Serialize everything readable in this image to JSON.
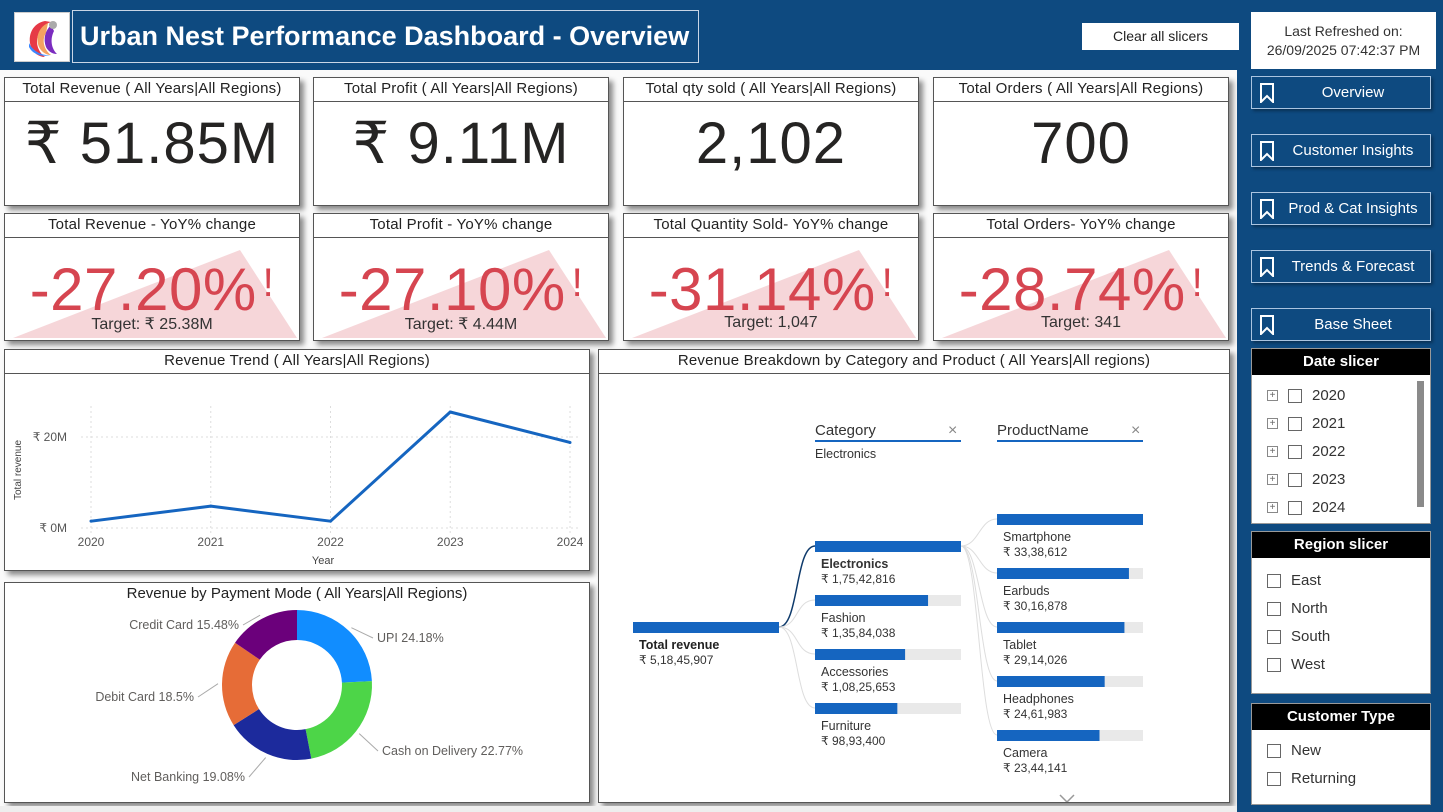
{
  "header": {
    "title": "Urban Nest Performance Dashboard - Overview",
    "clear_button": "Clear all slicers",
    "refresh_label": "Last Refreshed on:",
    "refresh_time": "26/09/2025  07:42:37 PM"
  },
  "kpis": [
    {
      "title": "Total Revenue ( All Years|All Regions)",
      "value": "₹ 51.85M"
    },
    {
      "title": "Total Profit ( All Years|All Regions)",
      "value": "₹ 9.11M"
    },
    {
      "title": "Total qty sold ( All Years|All Regions)",
      "value": "2,102"
    },
    {
      "title": "Total Orders ( All Years|All Regions)",
      "value": "700"
    }
  ],
  "yoy": [
    {
      "title": "Total Revenue  - YoY% change",
      "value": "-27.20%",
      "target": "Target: ₹ 25.38M",
      "alert": "!"
    },
    {
      "title": "Total Profit  - YoY% change",
      "value": "-27.10%",
      "target": "Target: ₹ 4.44M",
      "alert": "!"
    },
    {
      "title": "Total Quantity Sold- YoY% change",
      "value": "-31.14%",
      "target": "Target: 1,047",
      "alert": "!"
    },
    {
      "title": "Total Orders- YoY% change",
      "value": "-28.74%",
      "target": "Target: 341",
      "alert": "!"
    }
  ],
  "colors": {
    "navy": "#0e4a80",
    "negative": "#d64550",
    "line": "#1565c0",
    "bar": "#1565c0"
  },
  "nav": [
    {
      "label": "Overview",
      "icon": "bookmark-icon"
    },
    {
      "label": "Customer Insights",
      "icon": "bookmark-icon"
    },
    {
      "label": "Prod & Cat Insights",
      "icon": "bookmark-icon"
    },
    {
      "label": "Trends & Forecast",
      "icon": "bookmark-icon"
    },
    {
      "label": "Base Sheet",
      "icon": "bookmark-icon"
    }
  ],
  "date_slicer": {
    "title": "Date slicer",
    "items": [
      "2020",
      "2021",
      "2022",
      "2023",
      "2024"
    ]
  },
  "region_slicer": {
    "title": "Region slicer",
    "items": [
      "East",
      "North",
      "South",
      "West"
    ]
  },
  "customer_slicer": {
    "title": "Customer Type",
    "items": [
      "New",
      "Returning"
    ]
  },
  "chart_data": [
    {
      "type": "line",
      "title": "Revenue Trend ( All Years|All Regions)",
      "xlabel": "Year",
      "ylabel": "Total revenue",
      "x": [
        "2020",
        "2021",
        "2022",
        "2023",
        "2024"
      ],
      "values": [
        1.5,
        4.8,
        1.5,
        25.5,
        18.8
      ],
      "ylim": [
        0,
        25.5
      ],
      "yticks": [
        {
          "v": 0,
          "label": "₹ 0M"
        },
        {
          "v": 20,
          "label": "₹ 20M"
        }
      ],
      "grid": true
    },
    {
      "type": "pie",
      "title": "Revenue by Payment Mode ( All Years|All Regions)",
      "slices": [
        {
          "label": "UPI 24.18%",
          "value": 24.18,
          "color": "#118dff"
        },
        {
          "label": "Cash on Delivery 22.77%",
          "value": 22.77,
          "color": "#4dd548"
        },
        {
          "label": "Net Banking 19.08%",
          "value": 19.08,
          "color": "#1c2a9c"
        },
        {
          "label": "Debit Card 18.5%",
          "value": 18.5,
          "color": "#e66c37"
        },
        {
          "label": "Credit Card 15.48%",
          "value": 15.48,
          "color": "#6b007b"
        }
      ]
    },
    {
      "type": "bar",
      "title": "Revenue Breakdown by Category and Product ( All Years|All regions)",
      "root": {
        "label": "Total revenue",
        "value": "₹ 5,18,45,907"
      },
      "level1_header": "Category",
      "level1_selected": "Electronics",
      "level2_header": "ProductName",
      "categories": [
        {
          "label": "Electronics",
          "value_text": "₹ 1,75,42,816",
          "value": 17542816
        },
        {
          "label": "Fashion",
          "value_text": "₹ 1,35,84,038",
          "value": 13584038
        },
        {
          "label": "Accessories",
          "value_text": "₹ 1,08,25,653",
          "value": 10825653
        },
        {
          "label": "Furniture",
          "value_text": "₹ 98,93,400",
          "value": 9893400
        }
      ],
      "products": [
        {
          "label": "Smartphone",
          "value_text": "₹ 33,38,612",
          "value": 3338612
        },
        {
          "label": "Earbuds",
          "value_text": "₹ 30,16,878",
          "value": 3016878
        },
        {
          "label": "Tablet",
          "value_text": "₹ 29,14,026",
          "value": 2914026
        },
        {
          "label": "Headphones",
          "value_text": "₹ 24,61,983",
          "value": 2461983
        },
        {
          "label": "Camera",
          "value_text": "₹ 23,44,141",
          "value": 2344141
        }
      ]
    }
  ]
}
